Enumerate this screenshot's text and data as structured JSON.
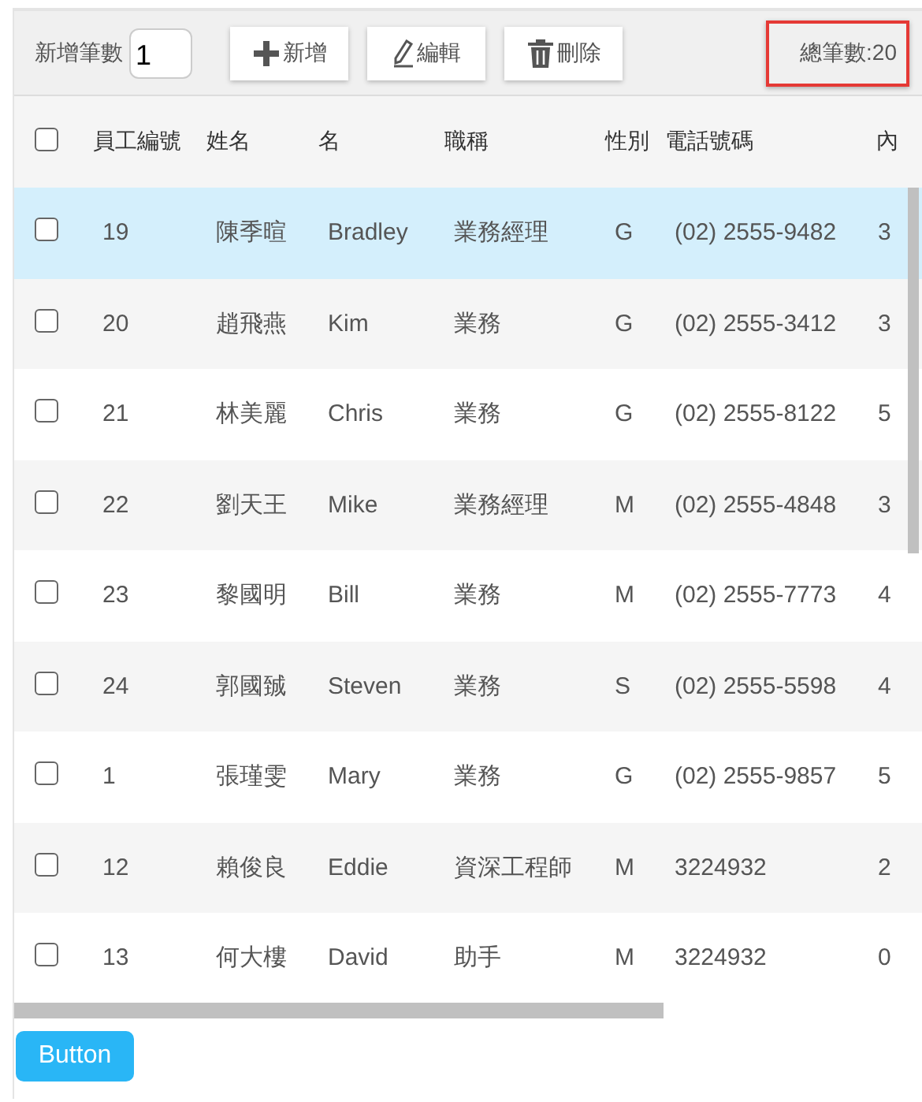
{
  "toolbar": {
    "count_label": "新增筆數",
    "count_field": {
      "value": "1"
    },
    "buttons": [
      {
        "kind": "add",
        "label": "新增"
      },
      {
        "kind": "edit",
        "label": "編輯"
      },
      {
        "kind": "delete",
        "label": "刪除"
      }
    ],
    "total": "總筆數:20"
  },
  "table": {
    "select_all": {
      "checked": false
    },
    "columns": [
      "員工編號",
      "姓名",
      "名",
      "職稱",
      "性別",
      "電話號碼",
      "內"
    ],
    "rows": [
      {
        "selected": true,
        "checked": false,
        "cells": [
          "19",
          "陳季暄",
          "Bradley",
          "業務經理",
          "G",
          "(02) 2555-9482",
          "3"
        ]
      },
      {
        "selected": false,
        "checked": false,
        "cells": [
          "20",
          "趙飛燕",
          "Kim",
          "業務",
          "G",
          "(02) 2555-3412",
          "3"
        ]
      },
      {
        "selected": false,
        "checked": false,
        "cells": [
          "21",
          "林美麗",
          "Chris",
          "業務",
          "G",
          "(02) 2555-8122",
          "5"
        ]
      },
      {
        "selected": false,
        "checked": false,
        "cells": [
          "22",
          "劉天王",
          "Mike",
          "業務經理",
          "M",
          "(02) 2555-4848",
          "3"
        ]
      },
      {
        "selected": false,
        "checked": false,
        "cells": [
          "23",
          "黎國明",
          "Bill",
          "業務",
          "M",
          "(02) 2555-7773",
          "4"
        ]
      },
      {
        "selected": false,
        "checked": false,
        "cells": [
          "24",
          "郭國臹",
          "Steven",
          "業務",
          "S",
          "(02) 2555-5598",
          "4"
        ]
      },
      {
        "selected": false,
        "checked": false,
        "cells": [
          "1",
          "張瑾雯",
          "Mary",
          "業務",
          "G",
          "(02) 2555-9857",
          "5"
        ]
      },
      {
        "selected": false,
        "checked": false,
        "cells": [
          "12",
          "賴俊良",
          "Eddie",
          "資深工程師",
          "M",
          "3224932",
          "2"
        ]
      },
      {
        "selected": false,
        "checked": false,
        "cells": [
          "13",
          "何大樓",
          "David",
          "助手",
          "M",
          "3224932",
          "0"
        ]
      }
    ]
  },
  "footer_button": {
    "label": "Button"
  }
}
